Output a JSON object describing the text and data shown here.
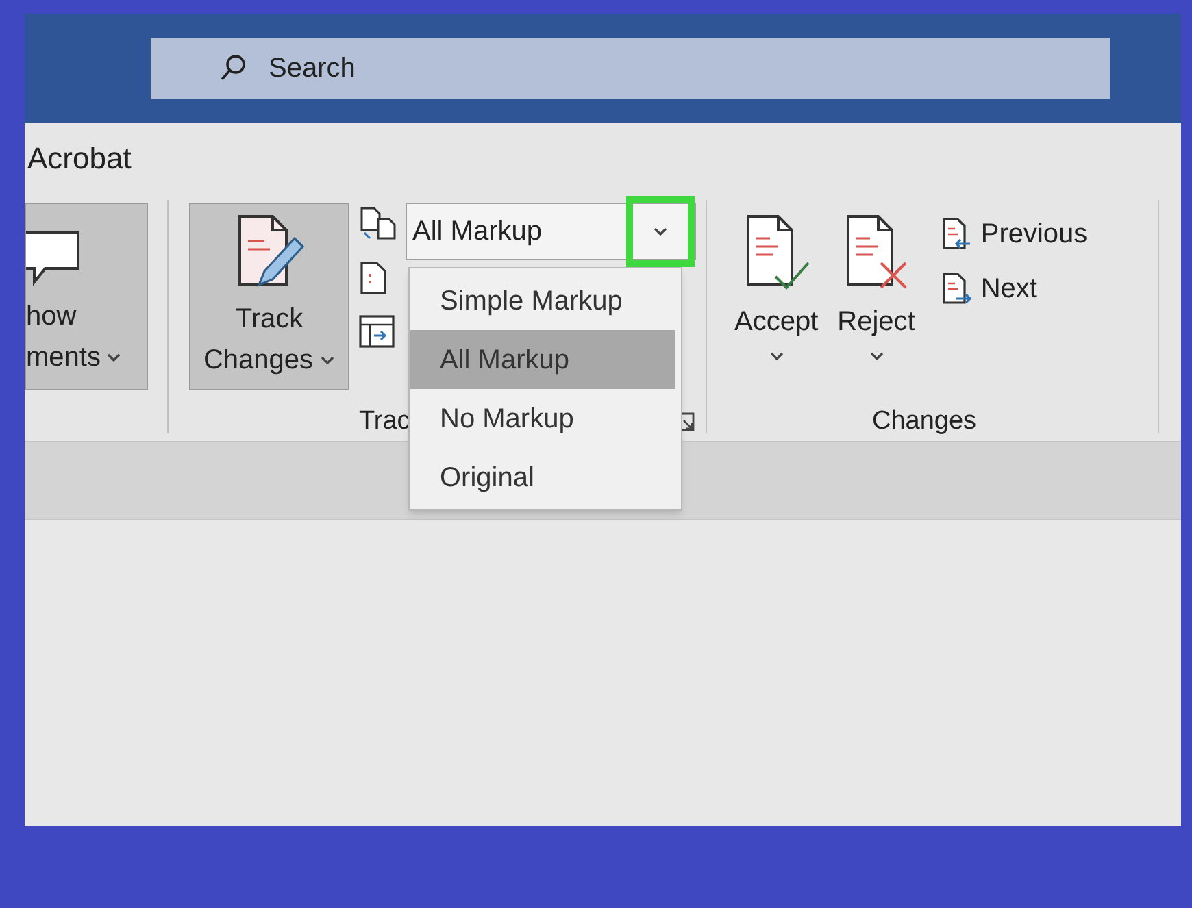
{
  "search": {
    "placeholder": "Search"
  },
  "tabs": [
    {
      "label": "Acrobat"
    }
  ],
  "show_comments": {
    "lines": [
      "how",
      "ments"
    ]
  },
  "track_changes": {
    "lines": [
      "Track",
      "Changes"
    ],
    "pressed": true
  },
  "markup_combo": {
    "value": "All Markup",
    "highlighted": true,
    "open": true,
    "options": [
      {
        "label": "Simple Markup",
        "selected": false
      },
      {
        "label": "All Markup",
        "selected": true
      },
      {
        "label": "No Markup",
        "selected": false
      },
      {
        "label": "Original",
        "selected": false
      }
    ]
  },
  "tracking_group": {
    "label": "Trac"
  },
  "changes_group": {
    "label": "Changes",
    "buttons": [
      {
        "label": "Accept",
        "kind": "accept"
      },
      {
        "label": "Reject",
        "kind": "reject"
      }
    ],
    "nav": [
      {
        "label": "Previous",
        "kind": "previous"
      },
      {
        "label": "Next",
        "kind": "next"
      }
    ]
  }
}
